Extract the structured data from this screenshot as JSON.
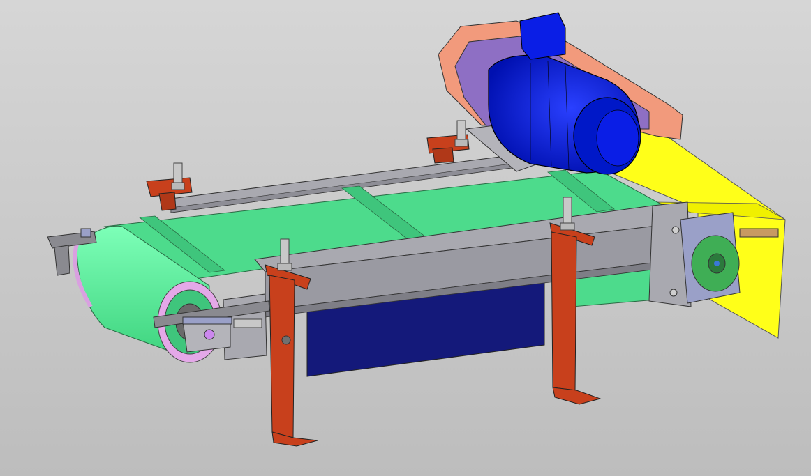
{
  "viewport": {
    "background_top": "#d6d6d6",
    "background_bottom": "#bdbdbd"
  },
  "model": {
    "parts": [
      {
        "name": "conveyor-belt",
        "color": "#4ddb8c"
      },
      {
        "name": "drive-motor",
        "color": "#0a1ee6"
      },
      {
        "name": "motor-guard",
        "color": "#f29a7c"
      },
      {
        "name": "belt-guard-cover",
        "color": "#ffff19"
      },
      {
        "name": "support-leg",
        "color": "#c8401c"
      },
      {
        "name": "frame-rail",
        "color": "#a9a9b0"
      },
      {
        "name": "underside-panel",
        "color": "#14197a"
      },
      {
        "name": "drive-flange",
        "color": "#3fae55"
      },
      {
        "name": "tensioner-bracket",
        "color": "#9aa0c8"
      },
      {
        "name": "tail-pulley",
        "color": "#5cf59a"
      }
    ]
  }
}
